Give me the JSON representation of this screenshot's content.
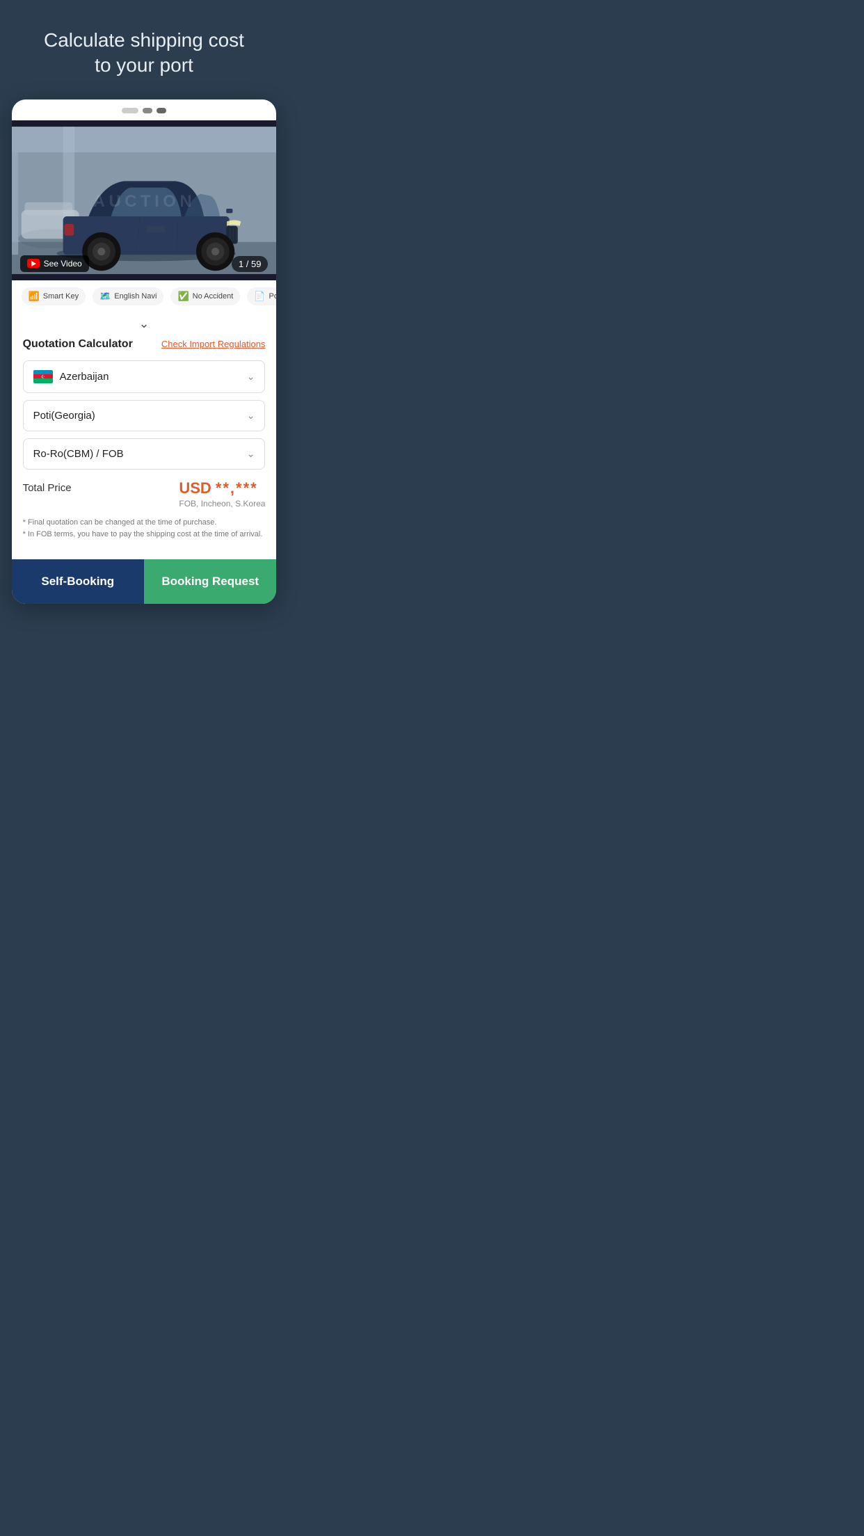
{
  "header": {
    "title": "Calculate shipping cost\nto your port",
    "background_color": "#2b3d4f"
  },
  "carousel": {
    "dots": [
      "inactive-long",
      "active",
      "active2"
    ]
  },
  "car_image": {
    "see_video_label": "See Video",
    "counter": "1 / 59",
    "watermark": "AUCTION",
    "alt": "Kia Sorento dark blue SUV in parking garage"
  },
  "features": [
    {
      "label": "Smart Key",
      "icon": "wifi"
    },
    {
      "label": "English Navi",
      "icon": "map"
    },
    {
      "label": "No Accident",
      "icon": "check"
    },
    {
      "label": "Polic...",
      "icon": "doc"
    }
  ],
  "expand_label": "▾",
  "quotation": {
    "title": "Quotation Calculator",
    "check_import_link": "Check Import Regulations"
  },
  "dropdowns": [
    {
      "id": "country",
      "value": "Azerbaijan",
      "has_flag": true,
      "flag_country": "AZ"
    },
    {
      "id": "port",
      "value": "Poti(Georgia)",
      "has_flag": false
    },
    {
      "id": "shipping_type",
      "value": "Ro-Ro(CBM) / FOB",
      "has_flag": false
    }
  ],
  "price": {
    "total_label": "Total Price",
    "currency": "USD",
    "amount_masked": "**,***",
    "sublabel": "FOB, Incheon, S.Korea"
  },
  "disclaimer": {
    "line1": "* Final quotation can be changed at the time of purchase.",
    "line2": "* In FOB terms, you have to pay the shipping cost at the time of arrival."
  },
  "buttons": {
    "self_booking": "Self-Booking",
    "booking_request": "Booking Request"
  }
}
